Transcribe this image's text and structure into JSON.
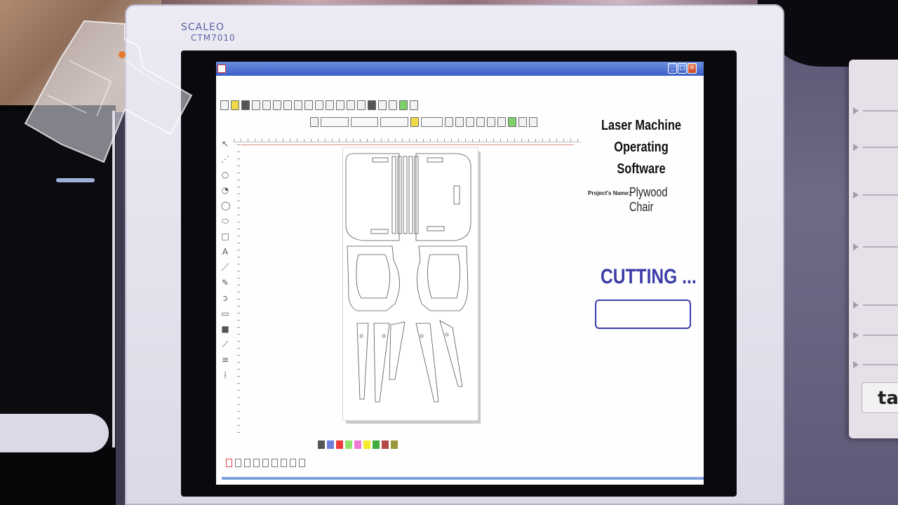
{
  "monitor": {
    "brand": "SCALEO",
    "model": "CTM7010"
  },
  "screen": {
    "app_title_line1": "Laser Machine",
    "app_title_line2": "Operating Software",
    "project_label": "Project's Name:",
    "project_name": "Plywood Chair",
    "status": "CUTTING ...",
    "progress": 0.0
  },
  "palette_colors": [
    "#555555",
    "#6d7ed9",
    "#ee3b3b",
    "#8fe36b",
    "#f07ad6",
    "#f6ec2e",
    "#3fae3f",
    "#b44a4a",
    "#9a9a3a"
  ],
  "sticky_note": {
    "tag": "ta"
  },
  "icons": [
    "minimap-icon",
    "new-file-icon",
    "open-folder-icon",
    "save-icon",
    "import-icon",
    "export-icon",
    "cut-icon",
    "copy-icon",
    "paste-icon",
    "undo-icon",
    "redo-icon",
    "zoom-in-icon",
    "zoom-out-icon",
    "delete-icon",
    "pointer-icon",
    "circle-icon",
    "rectangle-icon",
    "text-icon",
    "line-icon",
    "close-icon",
    "minimize-icon",
    "maximize-icon"
  ],
  "colors": {
    "accent": "#3b3ca8",
    "titlebar": "#3a5dc8"
  }
}
